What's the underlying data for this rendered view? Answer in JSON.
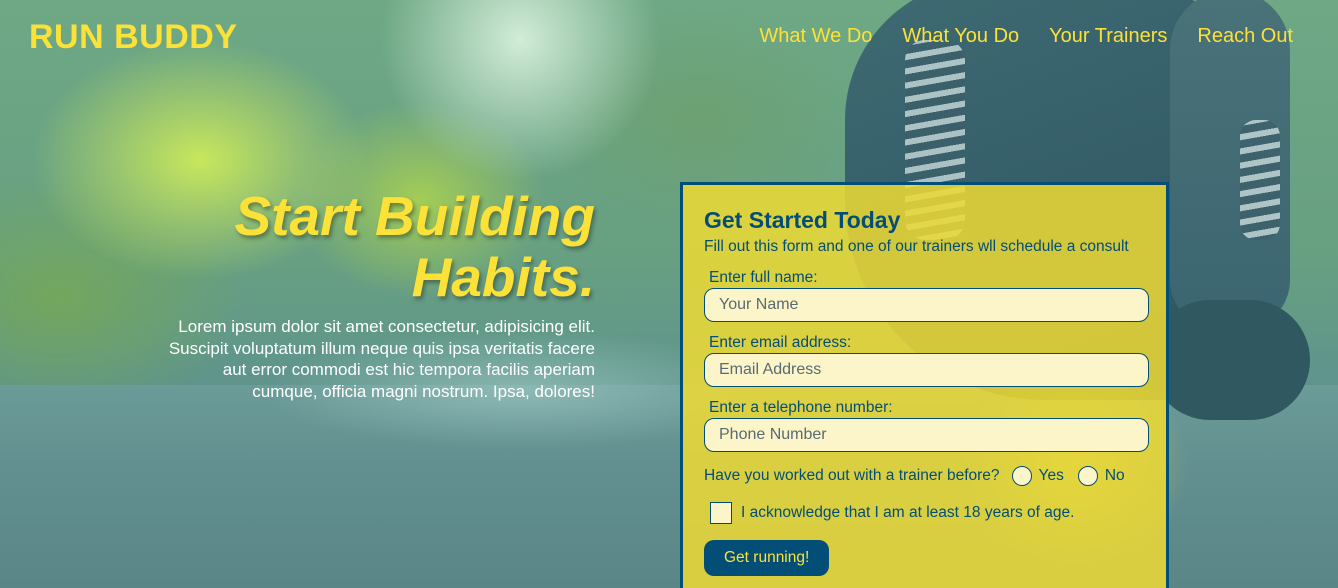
{
  "brand": {
    "name": "RUN BUDDY",
    "color_primary": "#fce138",
    "color_secondary": "#024e76"
  },
  "nav": {
    "items": [
      "What We Do",
      "What You Do",
      "Your Trainers",
      "Reach Out"
    ]
  },
  "hero": {
    "title": "Start Building Habits.",
    "text": "Lorem ipsum dolor sit amet consectetur, adipisicing elit. Suscipit voluptatum illum neque quis ipsa veritatis facere aut error commodi est hic tempora facilis aperiam cumque, officia magni nostrum. Ipsa, dolores!"
  },
  "form": {
    "title": "Get Started Today",
    "subtitle": "Fill out this form and one of our trainers wll schedule a consult",
    "name_label": "Enter full name:",
    "name_placeholder": "Your Name",
    "email_label": "Enter email address:",
    "email_placeholder": "Email Address",
    "phone_label": "Enter a telephone number:",
    "phone_placeholder": "Phone Number",
    "trainer_question": "Have you worked out with a trainer before?",
    "yes_label": "Yes",
    "no_label": "No",
    "age_ack": "I acknowledge that I am at least 18 years of age.",
    "submit_label": "Get running!"
  }
}
